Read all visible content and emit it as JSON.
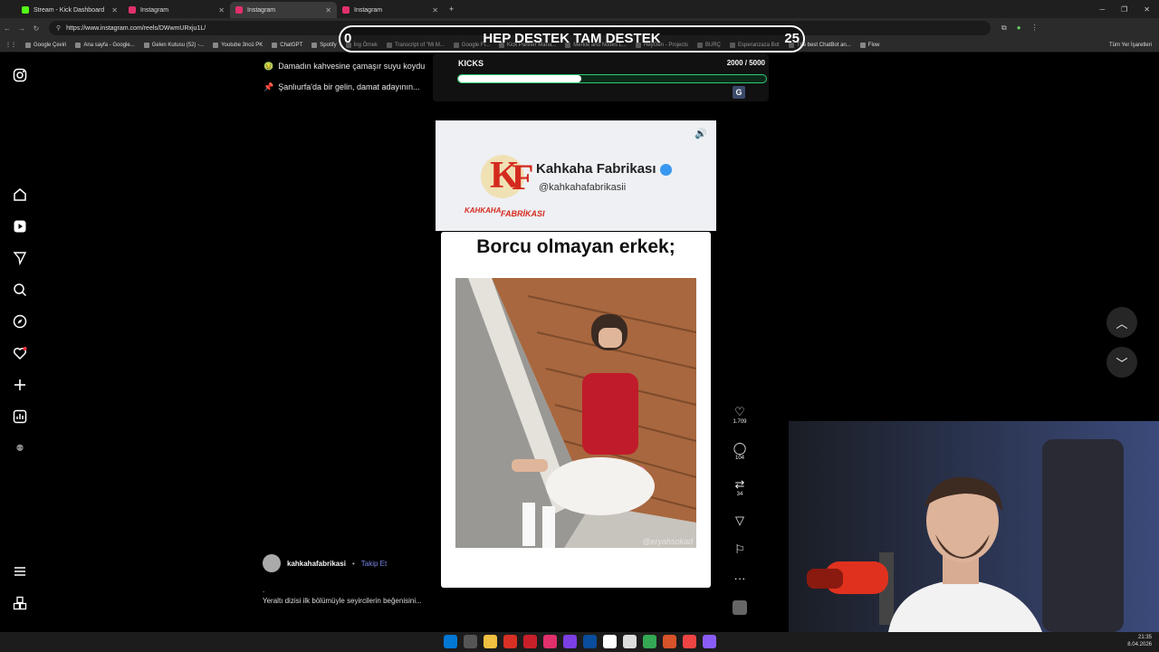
{
  "browser": {
    "tabs": [
      {
        "label": "Stream - Kick Dashboard",
        "color": "#53fc18"
      },
      {
        "label": "Instagram",
        "color": "#e1306c"
      },
      {
        "label": "Instagram",
        "color": "#e1306c",
        "active": true
      },
      {
        "label": "Instagram",
        "color": "#e1306c"
      }
    ],
    "url": "https://www.instagram.com/reels/DWwmURxju1L/",
    "bookmarks": [
      "Google Çeviri",
      "Ana sayfa - Google...",
      "Gelen Kutusu (52) -...",
      "Youtube 3ncü PK",
      "ChatGPT",
      "Spotify",
      "İng Örnek",
      "Transcript of \"Mi M...",
      "Google Fi...",
      "Kick Partner Mana...",
      "Merkle and Nodes L...",
      "HeyGen - Projects",
      "BURÇ",
      "Esperanzaza Bot",
      "The best ChatBot an...",
      "Flow"
    ],
    "bookmarks_right": "Tüm Yer İşaretleri"
  },
  "overlay": {
    "left": "0",
    "title": "HEP DESTEK TAM DESTEK",
    "right": "25"
  },
  "kicks": {
    "label": "KICKS",
    "count": "2000 / 5000",
    "progress": 0.4,
    "badge": "G"
  },
  "sidebar": {
    "icons": [
      "instagram-icon",
      "home-icon",
      "reels-icon",
      "send-icon",
      "search-icon",
      "explore-icon",
      "heart-icon",
      "create-icon",
      "dashboard-icon",
      "threads-icon",
      "menu-icon",
      "more-apps-icon"
    ]
  },
  "feed": {
    "items": [
      {
        "emoji": "🤢",
        "text": "Damadın kahvesine çamaşır suyu koydu"
      },
      {
        "emoji": "📌",
        "text": "Şanlıurfa'da bir gelin, damat adayının..."
      }
    ]
  },
  "reel": {
    "brand_title": "Kahkaha Fabrikası",
    "brand_handle": "@kahkahafabrikasii",
    "logo_text": "KAHKAHA FABRİKASI",
    "card_title": "Borcu olmayan erkek;",
    "watermark": "@eryahsokad"
  },
  "actions": {
    "likes": "1.709",
    "comments": "104",
    "reposts": "34"
  },
  "author": {
    "name": "kahkahafabrikasi",
    "separator": " • ",
    "follow": "Takip Et"
  },
  "caption": {
    "line0": ".",
    "text": "Yeraltı dizisi ilk bölümüyle seyircilerin beğenisini..."
  },
  "taskbar": {
    "time": "21:35",
    "date": "8.04.2026"
  },
  "colors": {
    "accent": "#3897f0",
    "follow": "#7a88e8",
    "kick_green": "#53fc18"
  }
}
